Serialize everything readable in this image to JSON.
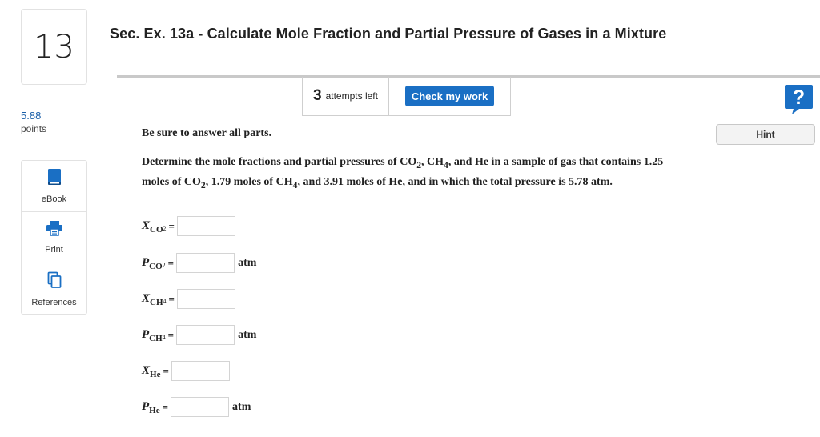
{
  "question": {
    "number": "13",
    "title": "Sec. Ex. 13a - Calculate Mole Fraction and Partial Pressure of Gases in a Mixture"
  },
  "toolbar": {
    "attempts_count": "3",
    "attempts_label": "attempts left",
    "check_label": "Check my work",
    "help_glyph": "?"
  },
  "points": {
    "value": "5.88",
    "label": "points"
  },
  "sidebar": {
    "items": [
      {
        "label": "eBook",
        "icon": "book-icon"
      },
      {
        "label": "Print",
        "icon": "printer-icon"
      },
      {
        "label": "References",
        "icon": "copy-icon"
      }
    ]
  },
  "hint_label": "Hint",
  "instruction": "Be sure to answer all parts.",
  "problem": {
    "p1": "Determine the mole fractions and partial pressures of CO",
    "s1": "2",
    "p2": ", CH",
    "s2": "4",
    "p3": ", and He in a sample of gas that contains 1.25 moles of CO",
    "s3": "2",
    "p4": ", 1.79 moles of CH",
    "s4": "4",
    "p5": ", and 3.91 moles of He, and in which the total pressure is 5.78 atm."
  },
  "answers": [
    {
      "symbol": "X",
      "sub": "CO",
      "sub2": "2",
      "eq": "=",
      "unit": "",
      "value": ""
    },
    {
      "symbol": "P",
      "sub": "CO",
      "sub2": "2",
      "eq": "=",
      "unit": "atm",
      "value": ""
    },
    {
      "symbol": "X",
      "sub": "CH",
      "sub2": "4",
      "eq": "=",
      "unit": "",
      "value": ""
    },
    {
      "symbol": "P",
      "sub": "CH",
      "sub2": "4",
      "eq": "=",
      "unit": "atm",
      "value": ""
    },
    {
      "symbol": "X",
      "sub": "He",
      "sub2": "",
      "eq": "=",
      "unit": "",
      "value": ""
    },
    {
      "symbol": "P",
      "sub": "He",
      "sub2": "",
      "eq": "=",
      "unit": "atm",
      "value": ""
    }
  ],
  "colors": {
    "accent": "#1a6fc4",
    "points": "#1a5fa8"
  }
}
